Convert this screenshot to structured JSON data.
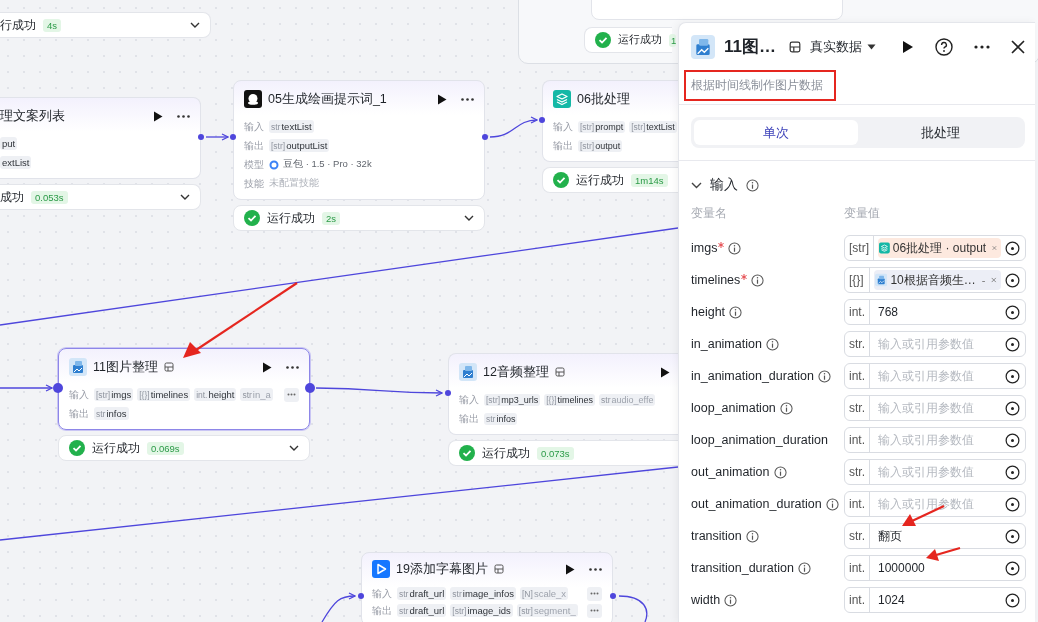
{
  "canvas": {
    "nodes": [
      {
        "kind": "status_only",
        "status": {
          "text": "行成功",
          "time": "4s"
        }
      },
      {
        "kind": "group",
        "status": {
          "text": "运行成功",
          "time": "1"
        }
      },
      {
        "kind": "cut",
        "title": "理文案列表",
        "selected": false,
        "rows": [
          {
            "params": [
              {
                "name": "put"
              }
            ]
          },
          {
            "params": [
              {
                "name": "extList"
              }
            ]
          }
        ],
        "status": {
          "text": "成功",
          "time": "0.053s"
        }
      },
      {
        "kind": "llm",
        "title": "05生成绘画提示词_1",
        "selected": false,
        "rows": [
          {
            "label": "输入",
            "params": [
              {
                "type": "str",
                "name": "textList"
              }
            ]
          },
          {
            "label": "输出",
            "params": [
              {
                "type": "[str]",
                "name": "outputList"
              }
            ]
          },
          {
            "label": "模型",
            "model": "豆包 · 1.5 · Pro · 32k"
          },
          {
            "label": "技能",
            "note": "未配置技能"
          }
        ],
        "status": {
          "text": "运行成功",
          "time": "2s"
        }
      },
      {
        "kind": "batch",
        "title": "06批处理",
        "selected": false,
        "rows": [
          {
            "label": "输入",
            "params": [
              {
                "type": "[str]",
                "name": "prompt"
              },
              {
                "type": "[str]",
                "name": "textList"
              }
            ]
          },
          {
            "label": "输出",
            "params": [
              {
                "type": "[str]",
                "name": "output"
              }
            ]
          }
        ],
        "status": {
          "text": "运行成功",
          "time": "1m14s"
        }
      },
      {
        "kind": "plugin",
        "title": "11图片整理",
        "selected": true,
        "rows": [
          {
            "label": "输入",
            "params": [
              {
                "type": "[str]",
                "name": "imgs"
              },
              {
                "type": "[{}]",
                "name": "timelines"
              },
              {
                "type": "int.",
                "name": "height"
              },
              {
                "type": "str",
                "name": "in_a",
                "faded": true
              }
            ]
          },
          {
            "label": "输出",
            "params": [
              {
                "type": "str",
                "name": "infos"
              }
            ]
          }
        ],
        "status": {
          "text": "运行成功",
          "time": "0.069s"
        }
      },
      {
        "kind": "plugin",
        "title": "12音频整理",
        "selected": false,
        "rows": [
          {
            "label": "输入",
            "params": [
              {
                "type": "[str]",
                "name": "mp3_urls"
              },
              {
                "type": "[{}]",
                "name": "timelines"
              },
              {
                "type": "str",
                "name": "audio_effe",
                "faded": true
              }
            ]
          },
          {
            "label": "输出",
            "params": [
              {
                "type": "str",
                "name": "infos"
              }
            ]
          }
        ],
        "status": {
          "text": "运行成功",
          "time": "0.073s"
        }
      },
      {
        "kind": "video",
        "title": "19添加字幕图片",
        "selected": false,
        "rows": [
          {
            "label": "输入",
            "params": [
              {
                "type": "str",
                "name": "draft_url"
              },
              {
                "type": "str",
                "name": "image_infos"
              },
              {
                "type": "[N]",
                "name": "scale_x",
                "faded": true
              }
            ]
          },
          {
            "label": "输出",
            "params": [
              {
                "type": "str",
                "name": "draft_url"
              },
              {
                "type": "[str]",
                "name": "image_ids"
              },
              {
                "type": "[str]",
                "name": "segment_",
                "faded": true
              }
            ]
          }
        ]
      }
    ]
  },
  "panel": {
    "kind": "plugin",
    "title": "11图…",
    "mode": "真实数据",
    "description": "根据时间线制作图片数据",
    "tabs": [
      {
        "label": "单次",
        "selected": true
      },
      {
        "label": "批处理",
        "selected": false
      }
    ],
    "section": {
      "title": "输入",
      "expanded": true,
      "columns": [
        "变量名",
        "变量值"
      ],
      "params": [
        {
          "name": "imgs",
          "required": true,
          "info": true,
          "type": "[str]",
          "ref": {
            "kind": "batch",
            "label": "06批处理 · output",
            "color": "#fde9df"
          }
        },
        {
          "name": "timelines",
          "required": true,
          "info": true,
          "type": "[{}]",
          "ref": {
            "kind": "plugin",
            "label": "10根据音频生…",
            "trail": "-",
            "color": "#eceef6"
          }
        },
        {
          "name": "height",
          "required": false,
          "info": true,
          "type": "int.",
          "value": "768"
        },
        {
          "name": "in_animation",
          "required": false,
          "info": true,
          "type": "str.",
          "placeholder": "输入或引用参数值"
        },
        {
          "name": "in_animation_duration",
          "required": false,
          "info": true,
          "type": "int.",
          "placeholder": "输入或引用参数值"
        },
        {
          "name": "loop_animation",
          "required": false,
          "info": true,
          "type": "str.",
          "placeholder": "输入或引用参数值"
        },
        {
          "name": "loop_animation_duration",
          "required": false,
          "info": false,
          "type": "int.",
          "placeholder": "输入或引用参数值"
        },
        {
          "name": "out_animation",
          "required": false,
          "info": true,
          "type": "str.",
          "placeholder": "输入或引用参数值"
        },
        {
          "name": "out_animation_duration",
          "required": false,
          "info": true,
          "type": "int.",
          "placeholder": "输入或引用参数值"
        },
        {
          "name": "transition",
          "required": false,
          "info": true,
          "type": "str.",
          "value": "翻页"
        },
        {
          "name": "transition_duration",
          "required": false,
          "info": true,
          "type": "int.",
          "value": "1000000"
        },
        {
          "name": "width",
          "required": false,
          "info": true,
          "type": "int.",
          "value": "1024"
        }
      ]
    }
  }
}
